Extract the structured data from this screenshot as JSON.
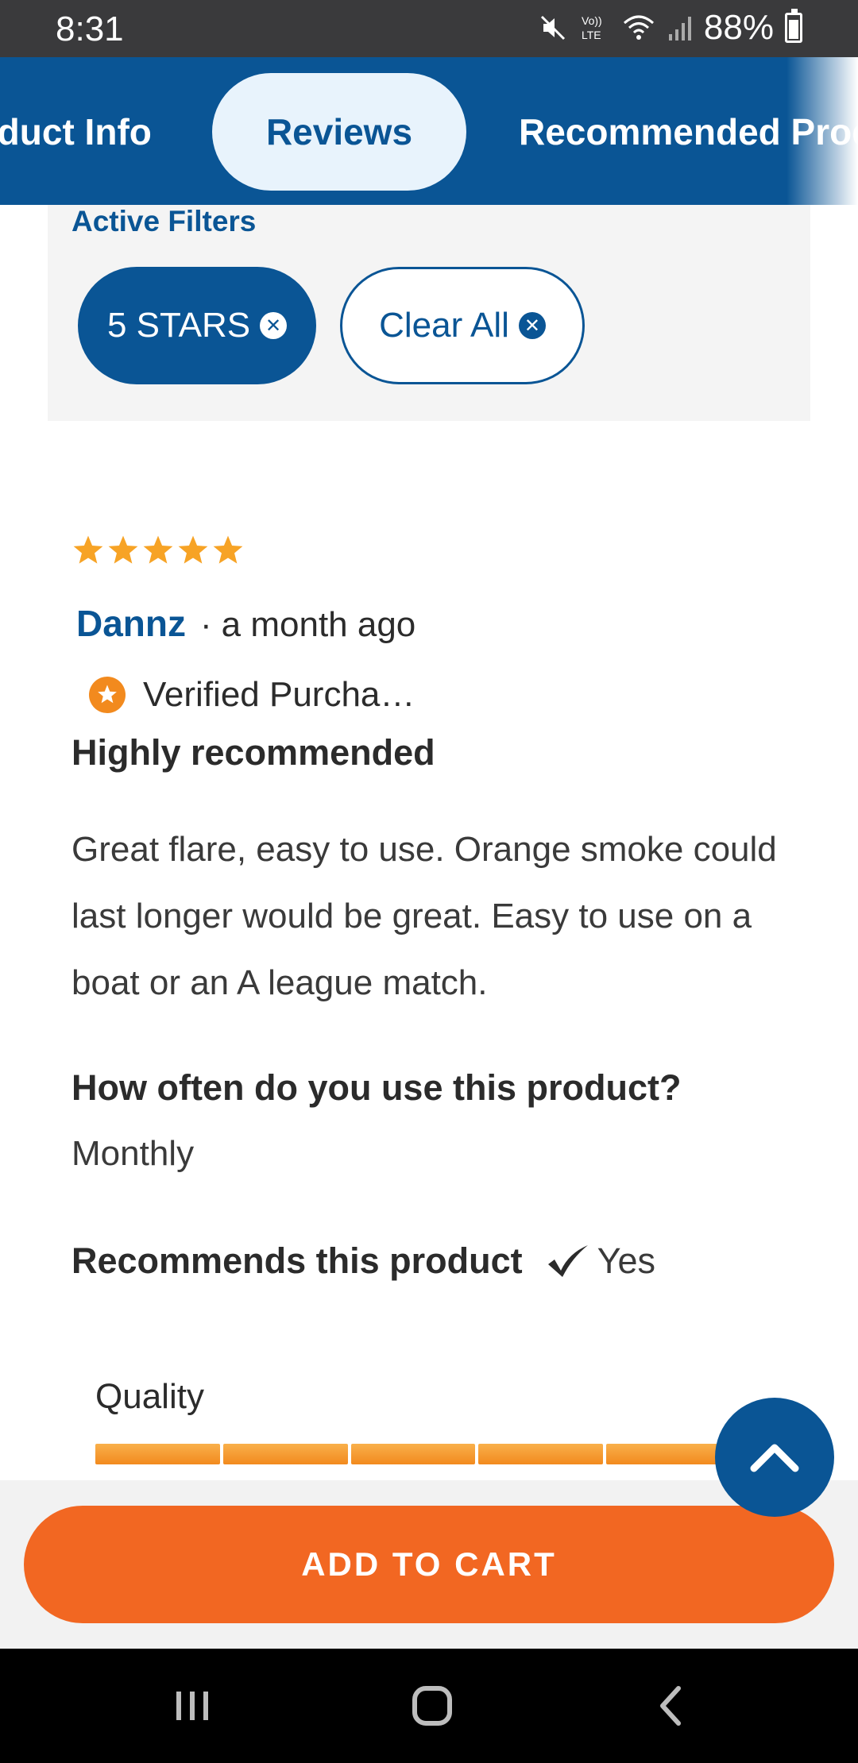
{
  "status_bar": {
    "time": "8:31",
    "battery": "88%",
    "network": "LTE"
  },
  "tabs": [
    {
      "label": "Product Info"
    },
    {
      "label": "Reviews",
      "active": true
    },
    {
      "label": "Recommended Products"
    }
  ],
  "filters": {
    "title": "Active Filters",
    "chips": [
      {
        "label": "5 STARS"
      },
      {
        "label": "Clear All"
      }
    ]
  },
  "review": {
    "rating": 5,
    "author": "Dannz",
    "separator": "·",
    "time": "a month ago",
    "verified": "Verified Purcha…",
    "title": "Highly recommended",
    "body": "Great flare, easy to use. Orange smoke could last longer would be great. Easy to use on a boat or an A league match.",
    "question": "How often do you use this product?",
    "answer": "Monthly",
    "recommends_label": "Recommends this product",
    "recommends_value": "Yes",
    "quality_label": "Quality",
    "quality_value": 5
  },
  "cart": {
    "label": "ADD TO CART"
  },
  "colors": {
    "primary": "#0a5595",
    "accent": "#f26722",
    "star": "#f7a325"
  },
  "icons": [
    "mute-icon",
    "lte-icon",
    "wifi-icon",
    "signal-icon",
    "battery-icon",
    "close-circle-icon",
    "star-icon",
    "verified-badge-icon",
    "check-icon",
    "chevron-up-icon",
    "recent-apps-icon",
    "home-icon",
    "back-icon"
  ]
}
